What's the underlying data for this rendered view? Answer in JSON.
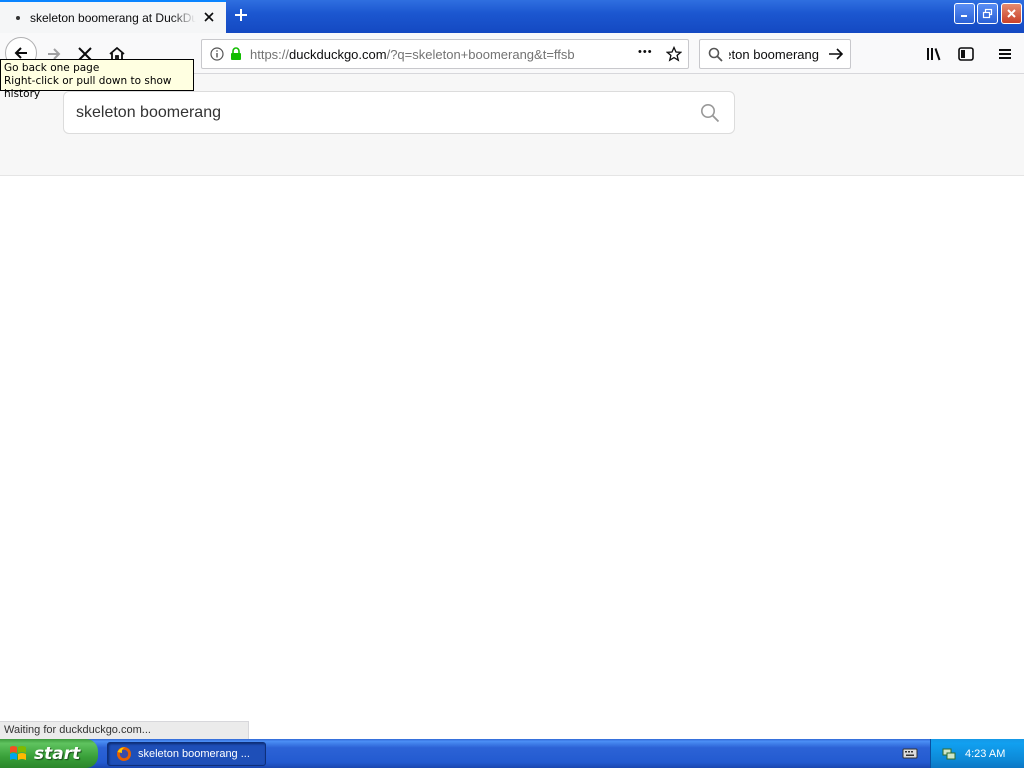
{
  "browser": {
    "tab": {
      "title": "skeleton boomerang at DuckDuckGo"
    },
    "urlbar": {
      "url_prefix": "https://",
      "url_host": "duckduckgo.com",
      "url_rest": "/?q=skeleton+boomerang&t=ffsb",
      "more_label": "•••"
    },
    "searchbar": {
      "value": "skeleton boomerang"
    },
    "tooltip": {
      "line1": "Go back one page",
      "line2": "Right-click or pull down to show history"
    },
    "status": "Waiting for duckduckgo.com..."
  },
  "page": {
    "search": {
      "query": "skeleton boomerang"
    }
  },
  "taskbar": {
    "start_label": "start",
    "task_label": "skeleton boomerang ...",
    "clock": "4:23 AM"
  },
  "icons": {
    "back": "back-arrow-icon",
    "forward": "forward-arrow-icon",
    "stop": "stop-icon",
    "home": "home-icon",
    "info": "info-icon",
    "lock": "lock-icon",
    "star": "bookmark-star-icon",
    "search": "search-icon",
    "go": "go-arrow-icon",
    "library": "library-icon",
    "sidebar": "sidebar-icon",
    "menu": "hamburger-menu-icon"
  },
  "colors": {
    "accent": "#0a84ff",
    "lock": "#12bc00",
    "xp_blue": "#245edb",
    "xp_green": "#3aa13a"
  }
}
